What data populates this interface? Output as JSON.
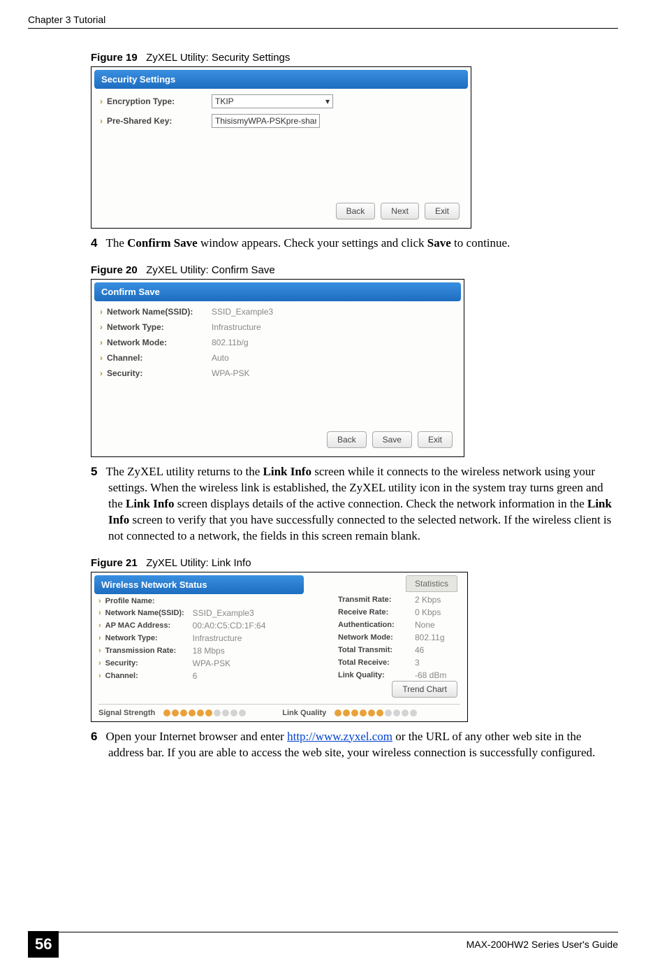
{
  "header": {
    "chapter": "Chapter 3 Tutorial"
  },
  "fig19": {
    "caption_num": "Figure 19",
    "caption_text": "ZyXEL Utility: Security Settings",
    "title": "Security Settings",
    "encryption_label": "Encryption Type:",
    "encryption_value": "TKIP",
    "psk_label": "Pre-Shared Key:",
    "psk_value": "ThisismyWPA-PSKpre-sharedkey",
    "back": "Back",
    "next": "Next",
    "exit": "Exit"
  },
  "step4": {
    "num": "4",
    "text_a": "The ",
    "b1": "Confirm Save",
    "text_b": " window appears. Check your settings and click ",
    "b2": "Save",
    "text_c": " to continue."
  },
  "fig20": {
    "caption_num": "Figure 20",
    "caption_text": "ZyXEL Utility: Confirm Save",
    "title": "Confirm Save",
    "rows": [
      {
        "label": "Network Name(SSID):",
        "value": "SSID_Example3"
      },
      {
        "label": "Network Type:",
        "value": "Infrastructure"
      },
      {
        "label": "Network Mode:",
        "value": "802.11b/g"
      },
      {
        "label": "Channel:",
        "value": "Auto"
      },
      {
        "label": "Security:",
        "value": "WPA-PSK"
      }
    ],
    "back": "Back",
    "save": "Save",
    "exit": "Exit"
  },
  "step5": {
    "num": "5",
    "text_a": "The ZyXEL utility returns to the ",
    "b1": "Link Info",
    "text_b": " screen while it connects to the wireless network using your settings. When the wireless link is established, the ZyXEL utility icon in the system tray turns green and the ",
    "b2": "Link Info",
    "text_c": " screen displays details of the active connection. Check the network information in the ",
    "b3": "Link Info",
    "text_d": " screen to verify that you have successfully connected to the selected network. If the wireless client is not connected to a network, the fields in this screen remain blank."
  },
  "fig21": {
    "caption_num": "Figure 21",
    "caption_text": "ZyXEL Utility: Link Info",
    "title": "Wireless Network Status",
    "stats_tab": "Statistics",
    "left": [
      {
        "label": "Profile Name:",
        "value": ""
      },
      {
        "label": "Network Name(SSID):",
        "value": "SSID_Example3"
      },
      {
        "label": "AP MAC Address:",
        "value": "00:A0:C5:CD:1F:64"
      },
      {
        "label": "Network Type:",
        "value": "Infrastructure"
      },
      {
        "label": "Transmission Rate:",
        "value": "18 Mbps"
      },
      {
        "label": "Security:",
        "value": "WPA-PSK"
      },
      {
        "label": "Channel:",
        "value": "6"
      }
    ],
    "right": [
      {
        "label": "Transmit Rate:",
        "value": "2 Kbps"
      },
      {
        "label": "Receive Rate:",
        "value": "0 Kbps"
      },
      {
        "label": "Authentication:",
        "value": "None"
      },
      {
        "label": "Network Mode:",
        "value": "802.11g"
      },
      {
        "label": "Total Transmit:",
        "value": "46"
      },
      {
        "label": "Total Receive:",
        "value": "3"
      },
      {
        "label": "Link Quality:",
        "value": "-68 dBm"
      }
    ],
    "trend": "Trend Chart",
    "sig_label": "Signal Strength",
    "lq_label": "Link Quality"
  },
  "step6": {
    "num": "6",
    "text_a": "Open your Internet browser and enter ",
    "link": "http://www.zyxel.com",
    "text_b": " or the URL of any other web site in the address bar. If you are able to access the web site, your wireless connection is successfully configured."
  },
  "footer": {
    "page": "56",
    "guide": "MAX-200HW2 Series User's Guide"
  }
}
